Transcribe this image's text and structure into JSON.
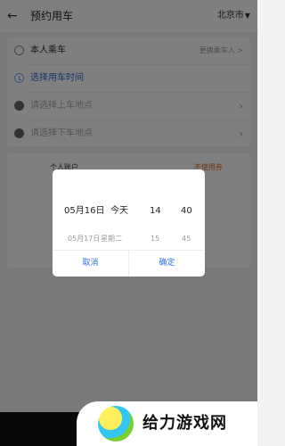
{
  "header": {
    "title": "预约用车",
    "city": "北京市",
    "back_icon": "arrow-left-icon",
    "city_icon": "caret-down-icon"
  },
  "form": {
    "passenger": {
      "label": "本人乘车",
      "action": "更换乘车人 >"
    },
    "time": {
      "label": "选择用车时间",
      "color": "#2f6fe0"
    },
    "pickup": {
      "placeholder": "请选择上车地点"
    },
    "dropoff": {
      "placeholder": "请选择下车地点"
    }
  },
  "payment": {
    "personal": "个人账户",
    "company": "不使用券"
  },
  "picker": {
    "selected": {
      "date": "05月16日",
      "day": "今天",
      "hour": "14",
      "minute": "40"
    },
    "next": {
      "date": "05月17日",
      "day": "星期二",
      "hour": "15",
      "minute": "45"
    },
    "cancel_label": "取消",
    "confirm_label": "确定",
    "accent": "#2f6fe0"
  },
  "watermark": {
    "text": "给力游戏网"
  }
}
